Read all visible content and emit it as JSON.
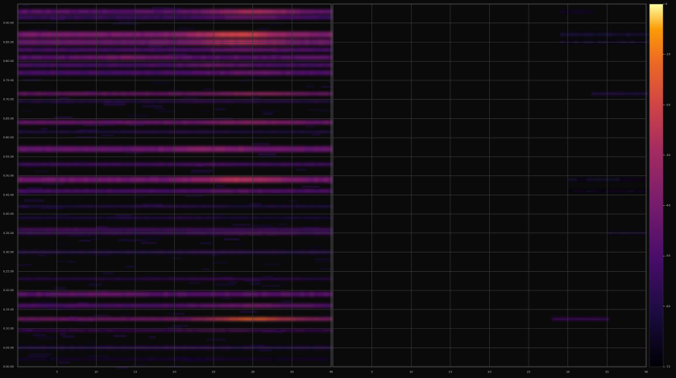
{
  "chart_data": {
    "type": "heatmap",
    "title": "",
    "xlabel": "",
    "ylabel": "",
    "panels": [
      {
        "name": "",
        "xlim": [
          0,
          40
        ],
        "x_ticks": [
          5,
          10,
          15,
          20,
          25,
          30,
          35,
          40
        ],
        "x_tick_labels": [
          "5",
          "10",
          "15",
          "20",
          "25",
          "30",
          "35",
          "40"
        ],
        "bands": [
          {
            "y": 1.28,
            "w": 0.012,
            "i": 0.35,
            "peak": 30,
            "pa": 0.25
          },
          {
            "y": 1.265,
            "w": 0.01,
            "i": 0.25,
            "peak": 30,
            "pa": 0.15
          },
          {
            "y": 1.22,
            "w": 0.015,
            "i": 0.45,
            "peak": 28,
            "pa": 0.25
          },
          {
            "y": 1.2,
            "w": 0.015,
            "i": 0.4,
            "peak": 28,
            "pa": 0.2
          },
          {
            "y": 1.18,
            "w": 0.01,
            "i": 0.3,
            "peak": 30,
            "pa": 0.1
          },
          {
            "y": 1.16,
            "w": 0.012,
            "i": 0.35,
            "peak": 14,
            "pa": 0.1
          },
          {
            "y": 1.14,
            "w": 0.01,
            "i": 0.3,
            "peak": 25,
            "pa": 0.1
          },
          {
            "y": 1.12,
            "w": 0.012,
            "i": 0.3,
            "peak": 30,
            "pa": 0.1
          },
          {
            "y": 1.065,
            "w": 0.008,
            "i": 0.42,
            "peak": 30,
            "pa": 0.12
          },
          {
            "y": 1.045,
            "w": 0.006,
            "i": 0.2,
            "peak": 25,
            "pa": 0.05
          },
          {
            "y": 0.99,
            "w": 0.01,
            "i": 0.4,
            "peak": 30,
            "pa": 0.1
          },
          {
            "y": 0.965,
            "w": 0.006,
            "i": 0.18,
            "peak": 20,
            "pa": 0.05
          },
          {
            "y": 0.92,
            "w": 0.015,
            "i": 0.38,
            "peak": 25,
            "pa": 0.12
          },
          {
            "y": 0.88,
            "w": 0.008,
            "i": 0.28,
            "peak": 25,
            "pa": 0.05
          },
          {
            "y": 0.84,
            "w": 0.015,
            "i": 0.42,
            "peak": 28,
            "pa": 0.2
          },
          {
            "y": 0.81,
            "w": 0.01,
            "i": 0.3,
            "peak": 28,
            "pa": 0.08
          },
          {
            "y": 0.77,
            "w": 0.006,
            "i": 0.18,
            "peak": 20,
            "pa": 0.05
          },
          {
            "y": 0.74,
            "w": 0.006,
            "i": 0.15,
            "peak": 20,
            "pa": 0.05
          },
          {
            "y": 0.71,
            "w": 0.006,
            "i": 0.3,
            "peak": 6,
            "pa": 0.05
          },
          {
            "y": 0.7,
            "w": 0.008,
            "i": 0.25,
            "peak": 30,
            "pa": 0.1
          },
          {
            "y": 0.65,
            "w": 0.008,
            "i": 0.18,
            "peak": 25,
            "pa": 0.05
          },
          {
            "y": 0.58,
            "w": 0.005,
            "i": 0.22,
            "peak": 25,
            "pa": 0.08
          },
          {
            "y": 0.54,
            "w": 0.012,
            "i": 0.35,
            "peak": 10,
            "pa": 0.05
          },
          {
            "y": 0.51,
            "w": 0.01,
            "i": 0.32,
            "peak": 30,
            "pa": 0.1
          },
          {
            "y": 0.475,
            "w": 0.008,
            "i": 0.45,
            "peak": 30,
            "pa": 0.35
          },
          {
            "y": 0.445,
            "w": 0.005,
            "i": 0.3,
            "peak": 25,
            "pa": 0.08
          },
          {
            "y": 0.4,
            "w": 0.008,
            "i": 0.18,
            "peak": 20,
            "pa": 0.05
          },
          {
            "y": 0.37,
            "w": 0.005,
            "i": 0.12,
            "peak": 20,
            "pa": 0.05
          }
        ]
      },
      {
        "name": "",
        "xlim": [
          0,
          40
        ],
        "x_ticks": [
          5,
          10,
          15,
          20,
          25,
          30,
          35,
          40
        ],
        "x_tick_labels": [
          "5",
          "10",
          "15",
          "20",
          "25",
          "30",
          "35",
          "40"
        ],
        "bands": [
          {
            "y": 1.28,
            "w": 0.005,
            "i": 0.12,
            "xmin": 29,
            "xmax": 33,
            "peak": 31,
            "pa": 0.0
          },
          {
            "y": 1.22,
            "w": 0.008,
            "i": 0.12,
            "xmin": 29,
            "xmax": 40,
            "peak": 36,
            "pa": 0.0
          },
          {
            "y": 1.2,
            "w": 0.006,
            "i": 0.1,
            "xmin": 29,
            "xmax": 40,
            "peak": 36,
            "pa": 0.0
          },
          {
            "y": 1.065,
            "w": 0.006,
            "i": 0.18,
            "xmin": 33,
            "xmax": 40,
            "peak": 39,
            "pa": 0.0
          },
          {
            "y": 0.84,
            "w": 0.008,
            "i": 0.08,
            "xmin": 30,
            "xmax": 40,
            "peak": 38,
            "pa": 0.0
          },
          {
            "y": 0.81,
            "w": 0.006,
            "i": 0.06,
            "xmin": 30,
            "xmax": 40,
            "peak": 38,
            "pa": 0.0
          },
          {
            "y": 0.7,
            "w": 0.005,
            "i": 0.12,
            "xmin": 35,
            "xmax": 40,
            "peak": 39,
            "pa": 0.0
          },
          {
            "y": 0.475,
            "w": 0.006,
            "i": 0.25,
            "xmin": 28,
            "xmax": 35,
            "peak": 31,
            "pa": 0.05
          }
        ]
      }
    ],
    "ylim": [
      0.35,
      1.3
    ],
    "y_ticks": [
      0.35,
      0.4,
      0.45,
      0.5,
      0.55,
      0.6,
      0.65,
      0.7,
      0.75,
      0.8,
      0.85,
      0.9,
      0.95,
      1.0,
      1.05,
      1.1,
      1.15,
      1.2,
      1.25
    ],
    "y_tick_labels": [
      "0.00.00",
      "0.05.00",
      "0.10.00",
      "0.15.00",
      "0.20.00",
      "0.25.00",
      "0.30.00",
      "0.35.00",
      "0.40.00",
      "0.45.00",
      "0.50.00",
      "0.55.00",
      "0.60.00",
      "0.65.00",
      "0.70.00",
      "0.75.00",
      "0.80.00",
      "0.85.00",
      "0.90.00"
    ],
    "grid": true,
    "colorbar": {
      "colormap": "inferno",
      "range": [
        -72,
        0
      ],
      "ticks": [
        -72,
        -60,
        -50,
        -40,
        -30,
        -20,
        -10,
        0
      ],
      "tick_labels": [
        "-72",
        "-60",
        "-50",
        "-40",
        "-30",
        "-20",
        "-10",
        "0"
      ]
    },
    "colors": {
      "background": "#0a0a0a",
      "grid": "#3a3a3a",
      "frame": "#5a5a5a"
    }
  }
}
